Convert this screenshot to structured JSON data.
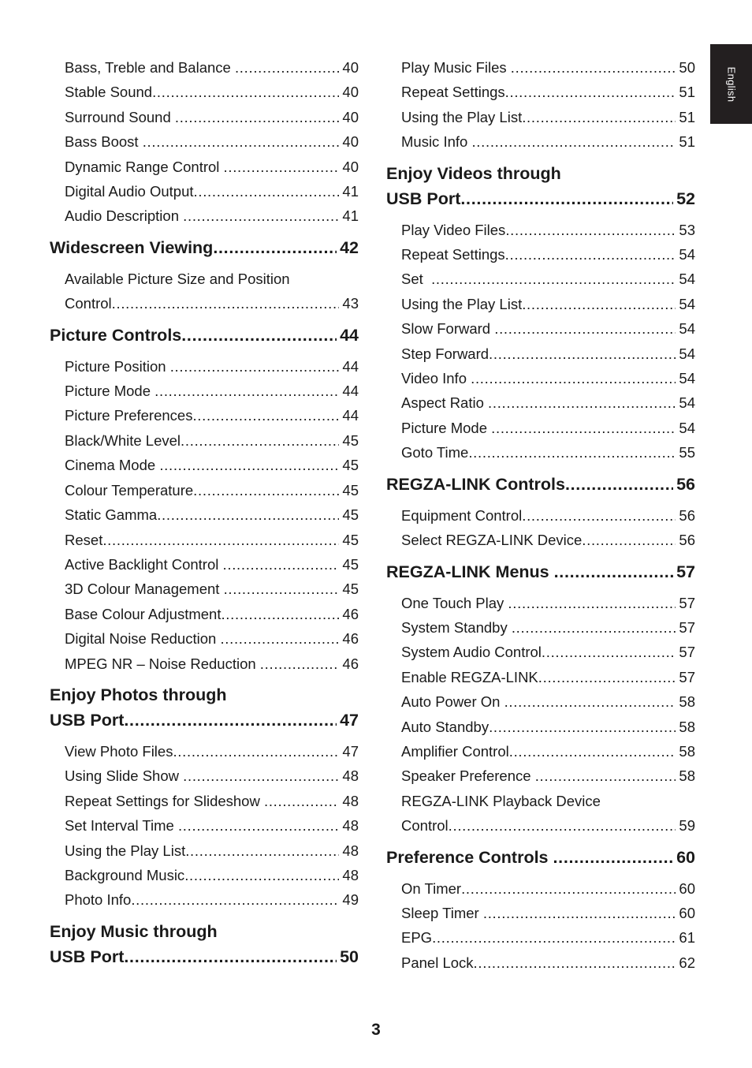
{
  "language_tab": {
    "label": "English"
  },
  "folio": {
    "page_number": "3"
  },
  "columns": {
    "left": [
      {
        "type": "item",
        "lines": [
          "Bass, Treble and Balance "
        ],
        "page": "40"
      },
      {
        "type": "item",
        "lines": [
          "Stable Sound"
        ],
        "page": "40"
      },
      {
        "type": "item",
        "lines": [
          "Surround Sound "
        ],
        "page": "40"
      },
      {
        "type": "item",
        "lines": [
          "Bass Boost "
        ],
        "page": "40"
      },
      {
        "type": "item",
        "lines": [
          "Dynamic Range Control "
        ],
        "page": "40"
      },
      {
        "type": "item",
        "lines": [
          "Digital Audio Output"
        ],
        "page": "41"
      },
      {
        "type": "item",
        "lines": [
          "Audio Description "
        ],
        "page": "41"
      },
      {
        "type": "heading",
        "lines": [
          "Widescreen Viewing"
        ],
        "page": "42"
      },
      {
        "type": "item",
        "lines": [
          "Available Picture Size and Position",
          "Control"
        ],
        "page": "43"
      },
      {
        "type": "heading",
        "lines": [
          "Picture Controls"
        ],
        "page": "44"
      },
      {
        "type": "item",
        "lines": [
          "Picture Position "
        ],
        "page": "44"
      },
      {
        "type": "item",
        "lines": [
          "Picture Mode "
        ],
        "page": "44"
      },
      {
        "type": "item",
        "lines": [
          "Picture Preferences"
        ],
        "page": "44"
      },
      {
        "type": "item",
        "lines": [
          "Black/White Level"
        ],
        "page": "45"
      },
      {
        "type": "item",
        "lines": [
          "Cinema Mode "
        ],
        "page": "45"
      },
      {
        "type": "item",
        "lines": [
          "Colour Temperature"
        ],
        "page": "45"
      },
      {
        "type": "item",
        "lines": [
          "Static Gamma"
        ],
        "page": "45"
      },
      {
        "type": "item",
        "lines": [
          "Reset"
        ],
        "page": "45"
      },
      {
        "type": "item",
        "lines": [
          "Active Backlight Control "
        ],
        "page": "45"
      },
      {
        "type": "item",
        "lines": [
          "3D Colour Management "
        ],
        "page": "45"
      },
      {
        "type": "item",
        "lines": [
          "Base Colour Adjustment"
        ],
        "page": "46"
      },
      {
        "type": "item",
        "lines": [
          "Digital Noise Reduction "
        ],
        "page": "46"
      },
      {
        "type": "item",
        "lines": [
          "MPEG NR – Noise Reduction "
        ],
        "page": "46"
      },
      {
        "type": "heading",
        "lines": [
          "Enjoy Photos through",
          "USB Port"
        ],
        "page": "47"
      },
      {
        "type": "item",
        "lines": [
          "View Photo Files"
        ],
        "page": "47"
      },
      {
        "type": "item",
        "lines": [
          "Using Slide Show "
        ],
        "page": "48"
      },
      {
        "type": "item",
        "lines": [
          "Repeat Settings for Slideshow "
        ],
        "page": "48"
      },
      {
        "type": "item",
        "lines": [
          "Set Interval Time "
        ],
        "page": "48"
      },
      {
        "type": "item",
        "lines": [
          "Using the Play List"
        ],
        "page": "48"
      },
      {
        "type": "item",
        "lines": [
          "Background Music"
        ],
        "page": "48"
      },
      {
        "type": "item",
        "lines": [
          "Photo Info"
        ],
        "page": "49"
      },
      {
        "type": "heading",
        "lines": [
          "Enjoy Music through",
          "USB Port"
        ],
        "page": "50"
      }
    ],
    "right": [
      {
        "type": "item",
        "lines": [
          "Play Music Files "
        ],
        "page": "50"
      },
      {
        "type": "item",
        "lines": [
          "Repeat Settings"
        ],
        "page": "51"
      },
      {
        "type": "item",
        "lines": [
          "Using the Play List"
        ],
        "page": "51"
      },
      {
        "type": "item",
        "lines": [
          "Music Info "
        ],
        "page": "51"
      },
      {
        "type": "heading",
        "lines": [
          "Enjoy Videos through",
          "USB Port"
        ],
        "page": "52"
      },
      {
        "type": "item",
        "lines": [
          "Play Video Files"
        ],
        "page": "53"
      },
      {
        "type": "item",
        "lines": [
          "Repeat Settings"
        ],
        "page": "54"
      },
      {
        "type": "item",
        "lines": [
          "Set  "
        ],
        "page": "54"
      },
      {
        "type": "item",
        "lines": [
          "Using the Play List"
        ],
        "page": "54"
      },
      {
        "type": "item",
        "lines": [
          "Slow Forward "
        ],
        "page": "54"
      },
      {
        "type": "item",
        "lines": [
          "Step Forward"
        ],
        "page": "54"
      },
      {
        "type": "item",
        "lines": [
          "Video Info "
        ],
        "page": "54"
      },
      {
        "type": "item",
        "lines": [
          "Aspect Ratio "
        ],
        "page": "54"
      },
      {
        "type": "item",
        "lines": [
          "Picture Mode "
        ],
        "page": "54"
      },
      {
        "type": "item",
        "lines": [
          "Goto Time"
        ],
        "page": "55"
      },
      {
        "type": "heading",
        "lines": [
          "REGZA-LINK Controls"
        ],
        "page": "56"
      },
      {
        "type": "item",
        "lines": [
          "Equipment Control"
        ],
        "page": "56"
      },
      {
        "type": "item",
        "lines": [
          "Select REGZA-LINK Device"
        ],
        "page": "56"
      },
      {
        "type": "heading",
        "lines": [
          "REGZA-LINK Menus "
        ],
        "page": "57"
      },
      {
        "type": "item",
        "lines": [
          "One Touch Play "
        ],
        "page": "57"
      },
      {
        "type": "item",
        "lines": [
          "System Standby "
        ],
        "page": "57"
      },
      {
        "type": "item",
        "lines": [
          "System Audio Control"
        ],
        "page": "57"
      },
      {
        "type": "item",
        "lines": [
          "Enable REGZA-LINK"
        ],
        "page": "57"
      },
      {
        "type": "item",
        "lines": [
          "Auto Power On "
        ],
        "page": "58"
      },
      {
        "type": "item",
        "lines": [
          "Auto Standby"
        ],
        "page": "58"
      },
      {
        "type": "item",
        "lines": [
          "Amplifier Control"
        ],
        "page": "58"
      },
      {
        "type": "item",
        "lines": [
          "Speaker Preference "
        ],
        "page": "58"
      },
      {
        "type": "item",
        "lines": [
          "REGZA-LINK Playback Device",
          "Control"
        ],
        "page": "59"
      },
      {
        "type": "heading",
        "lines": [
          "Preference Controls "
        ],
        "page": "60"
      },
      {
        "type": "item",
        "lines": [
          "On Timer"
        ],
        "page": "60"
      },
      {
        "type": "item",
        "lines": [
          "Sleep Timer "
        ],
        "page": "60"
      },
      {
        "type": "item",
        "lines": [
          "EPG"
        ],
        "page": "61"
      },
      {
        "type": "item",
        "lines": [
          "Panel Lock"
        ],
        "page": "62"
      }
    ]
  }
}
